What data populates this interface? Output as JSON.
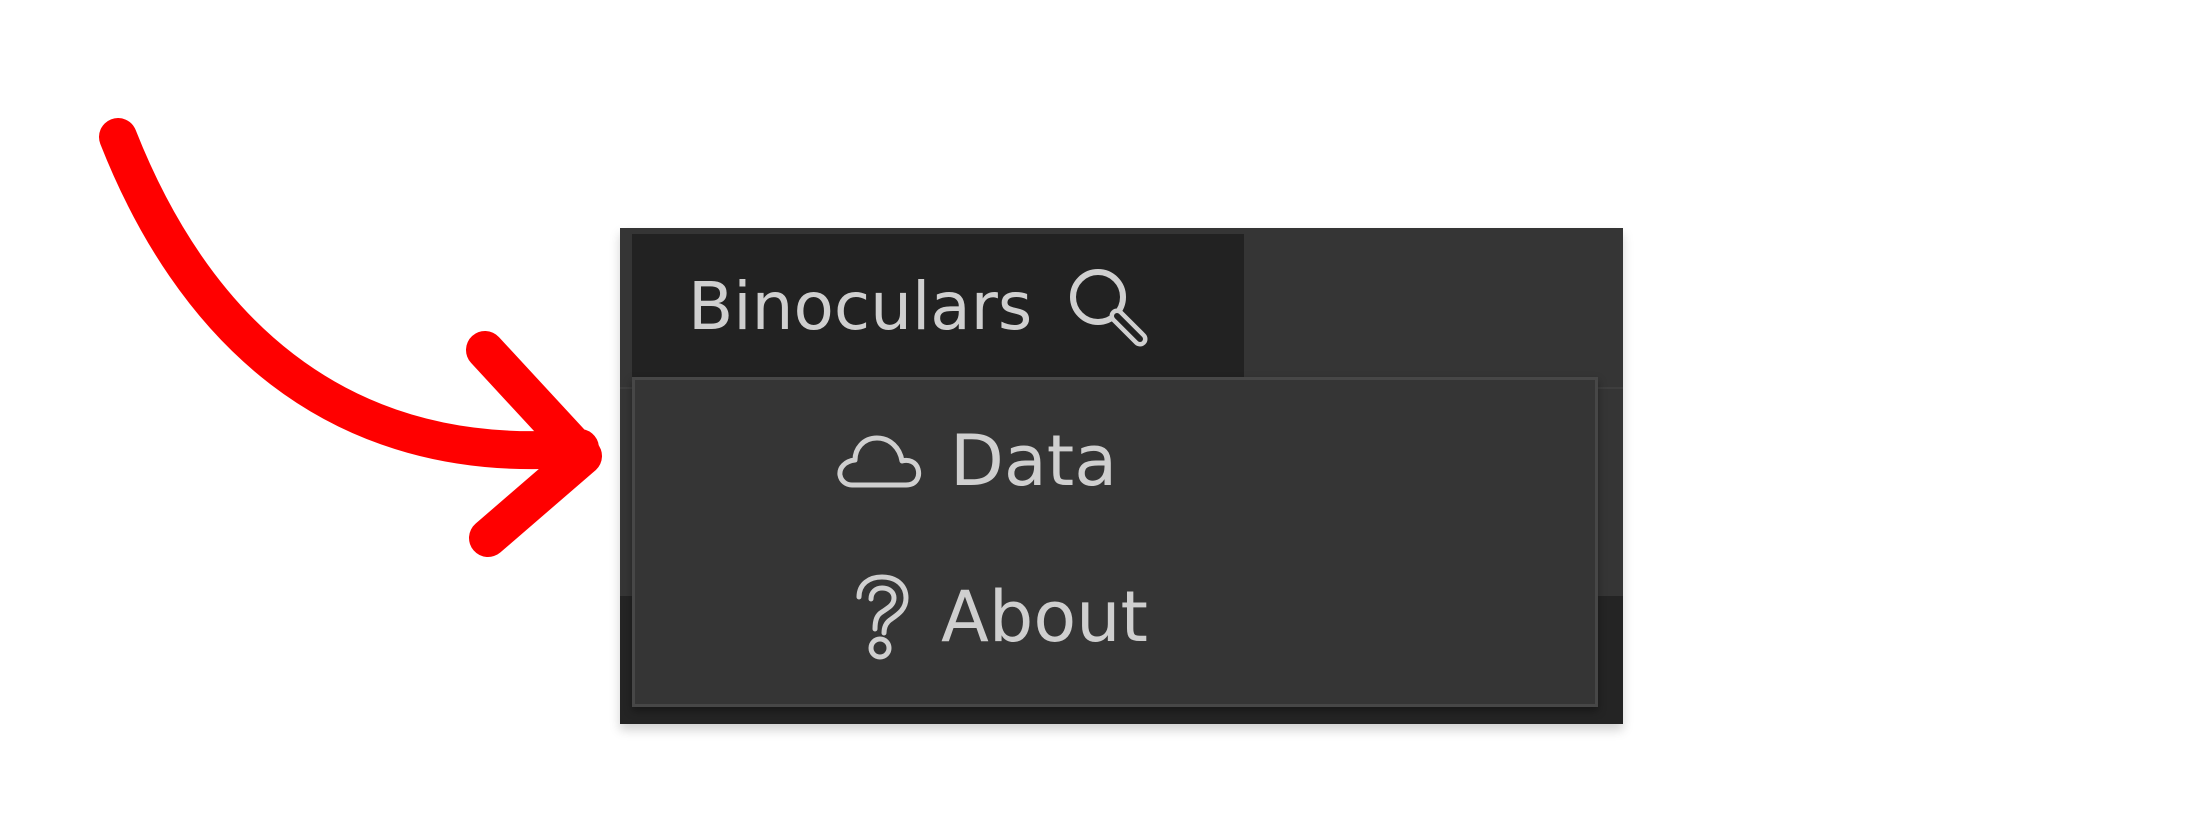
{
  "annotation": {
    "arrow_color": "#ff0000",
    "arrow_icon": "curved-arrow-icon"
  },
  "menubar": {
    "active_menu": {
      "label": "Binoculars",
      "icon": "magnifier-icon"
    }
  },
  "dropdown": {
    "items": [
      {
        "label": "Data",
        "icon": "cloud-icon"
      },
      {
        "label": "About",
        "icon": "question-icon"
      }
    ]
  },
  "colors": {
    "menubar_bg": "#353535",
    "active_menu_bg": "#222222",
    "dropdown_bg": "#353535",
    "dropdown_border": "#474747",
    "text": "#cfcfcf"
  }
}
